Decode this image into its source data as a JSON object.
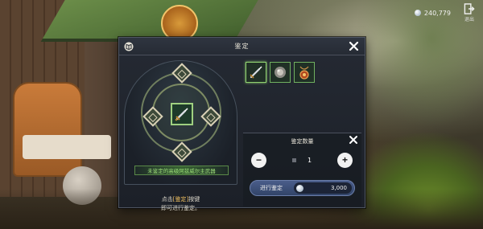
{
  "hud": {
    "currency_icon": "silver-coin-icon",
    "currency_value": "240,779",
    "exit_label": "退出"
  },
  "dialog": {
    "title": "鉴定",
    "item_name": "未鉴定的高级阿兹威尔主武器",
    "hint_prefix": "点击",
    "hint_highlight": "[鉴定]",
    "hint_suffix": "按键",
    "hint_line2": "即可进行鉴定。",
    "slots": [
      {
        "icon": "sword-icon"
      },
      {
        "icon": "stone-ore-icon"
      },
      {
        "icon": "amulet-icon"
      }
    ],
    "quantity": {
      "title": "鉴定数量",
      "value": "1",
      "minus_label": "−",
      "plus_label": "+"
    },
    "identify_button": {
      "label": "进行鉴定",
      "cost": "3,000",
      "cost_icon": "silver-coin-icon"
    }
  },
  "colors": {
    "accent_green": "#9fe07a",
    "highlight_gold": "#f0c060",
    "button_blue": "#3c4f78"
  }
}
